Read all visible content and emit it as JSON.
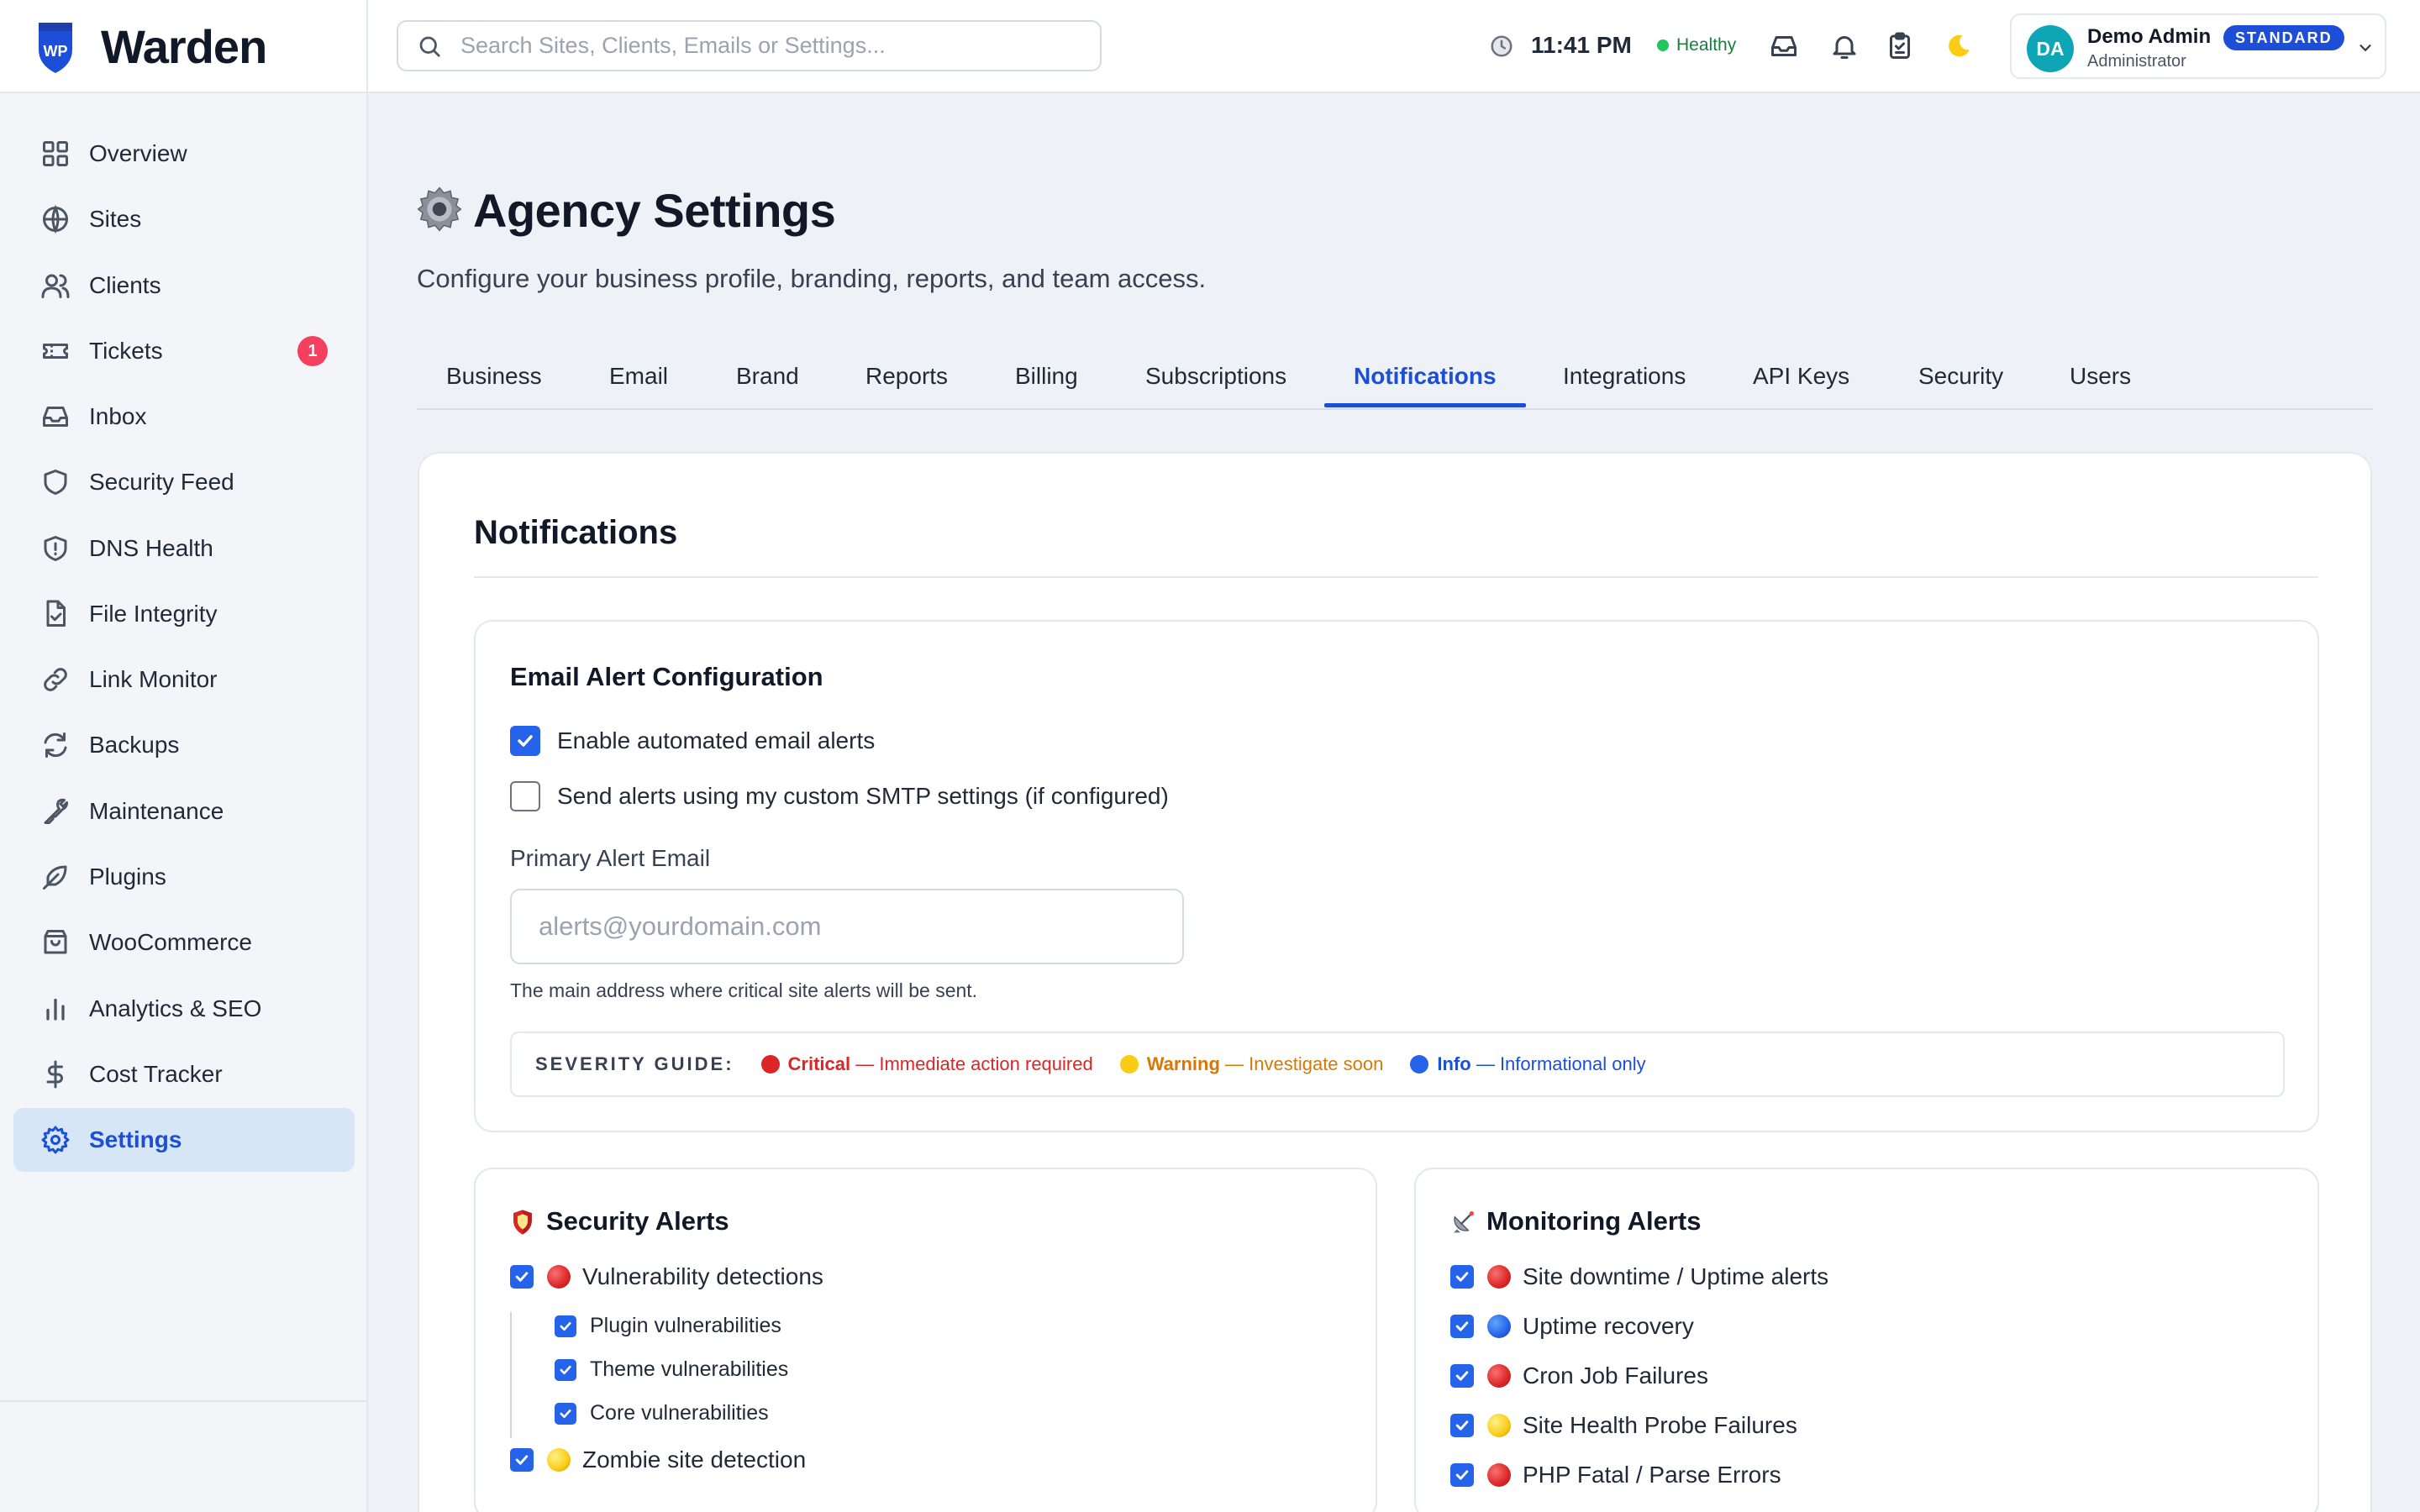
{
  "brand": {
    "name": "Warden",
    "logo_text": "WP"
  },
  "search": {
    "placeholder": "Search Sites, Clients, Emails or Settings..."
  },
  "topbar": {
    "time": "11:41 PM",
    "status": "Healthy",
    "status_color": "#22c55e"
  },
  "user": {
    "initials": "DA",
    "name": "Demo Admin",
    "badge": "STANDARD",
    "role": "Administrator"
  },
  "sidebar": {
    "items": [
      {
        "label": "Overview",
        "icon": "grid-icon"
      },
      {
        "label": "Sites",
        "icon": "globe-icon"
      },
      {
        "label": "Clients",
        "icon": "users-icon"
      },
      {
        "label": "Tickets",
        "icon": "ticket-icon",
        "badge": "1"
      },
      {
        "label": "Inbox",
        "icon": "inbox-icon"
      },
      {
        "label": "Security Feed",
        "icon": "shield-icon"
      },
      {
        "label": "DNS Health",
        "icon": "shield-alert-icon"
      },
      {
        "label": "File Integrity",
        "icon": "file-check-icon"
      },
      {
        "label": "Link Monitor",
        "icon": "link-icon"
      },
      {
        "label": "Backups",
        "icon": "refresh-icon"
      },
      {
        "label": "Maintenance",
        "icon": "wrench-icon"
      },
      {
        "label": "Plugins",
        "icon": "feather-icon"
      },
      {
        "label": "WooCommerce",
        "icon": "shopping-bag-icon"
      },
      {
        "label": "Analytics & SEO",
        "icon": "bar-chart-icon"
      },
      {
        "label": "Cost Tracker",
        "icon": "dollar-icon"
      },
      {
        "label": "Settings",
        "icon": "gear-icon",
        "active": true
      }
    ]
  },
  "page": {
    "title": "Agency Settings",
    "subtitle": "Configure your business profile, branding, reports, and team access."
  },
  "tabs": [
    {
      "label": "Business"
    },
    {
      "label": "Email"
    },
    {
      "label": "Brand"
    },
    {
      "label": "Reports"
    },
    {
      "label": "Billing"
    },
    {
      "label": "Subscriptions"
    },
    {
      "label": "Notifications",
      "active": true
    },
    {
      "label": "Integrations"
    },
    {
      "label": "API Keys"
    },
    {
      "label": "Security"
    },
    {
      "label": "Users"
    }
  ],
  "notifications": {
    "title": "Notifications",
    "email_config": {
      "title": "Email Alert Configuration",
      "enable_label": "Enable automated email alerts",
      "enable_checked": true,
      "smtp_label": "Send alerts using my custom SMTP settings (if configured)",
      "smtp_checked": false,
      "primary_label": "Primary Alert Email",
      "primary_value": "",
      "primary_placeholder": "alerts@yourdomain.com",
      "primary_help": "The main address where critical site alerts will be sent.",
      "severity": {
        "label": "SEVERITY GUIDE:",
        "critical": {
          "name": "Critical",
          "desc": "— Immediate action required",
          "color": "#dc2626"
        },
        "warning": {
          "name": "Warning",
          "desc": "— Investigate soon",
          "color": "#d97706"
        },
        "info": {
          "name": "Info",
          "desc": "— Informational only",
          "color": "#1d4ed8"
        }
      }
    },
    "security_alerts": {
      "title": "Security Alerts",
      "items": [
        {
          "label": "Vulnerability detections",
          "level": "critical",
          "checked": true
        },
        {
          "label": "Plugin vulnerabilities",
          "checked": true,
          "sub": true
        },
        {
          "label": "Theme vulnerabilities",
          "checked": true,
          "sub": true
        },
        {
          "label": "Core vulnerabilities",
          "checked": true,
          "sub": true
        },
        {
          "label": "Zombie site detection",
          "level": "warning",
          "checked": true
        }
      ]
    },
    "monitoring_alerts": {
      "title": "Monitoring Alerts",
      "items": [
        {
          "label": "Site downtime / Uptime alerts",
          "level": "critical",
          "checked": true
        },
        {
          "label": "Uptime recovery",
          "level": "info",
          "checked": true
        },
        {
          "label": "Cron Job Failures",
          "level": "critical",
          "checked": true
        },
        {
          "label": "Site Health Probe Failures",
          "level": "warning",
          "checked": true
        },
        {
          "label": "PHP Fatal / Parse Errors",
          "level": "critical",
          "checked": true
        }
      ]
    }
  },
  "colors": {
    "accent": "#1d4ed8",
    "checkbox": "#2563eb",
    "critical_dot": "#dc2626",
    "warning_dot": "#facc15",
    "info_dot": "#2563eb"
  }
}
